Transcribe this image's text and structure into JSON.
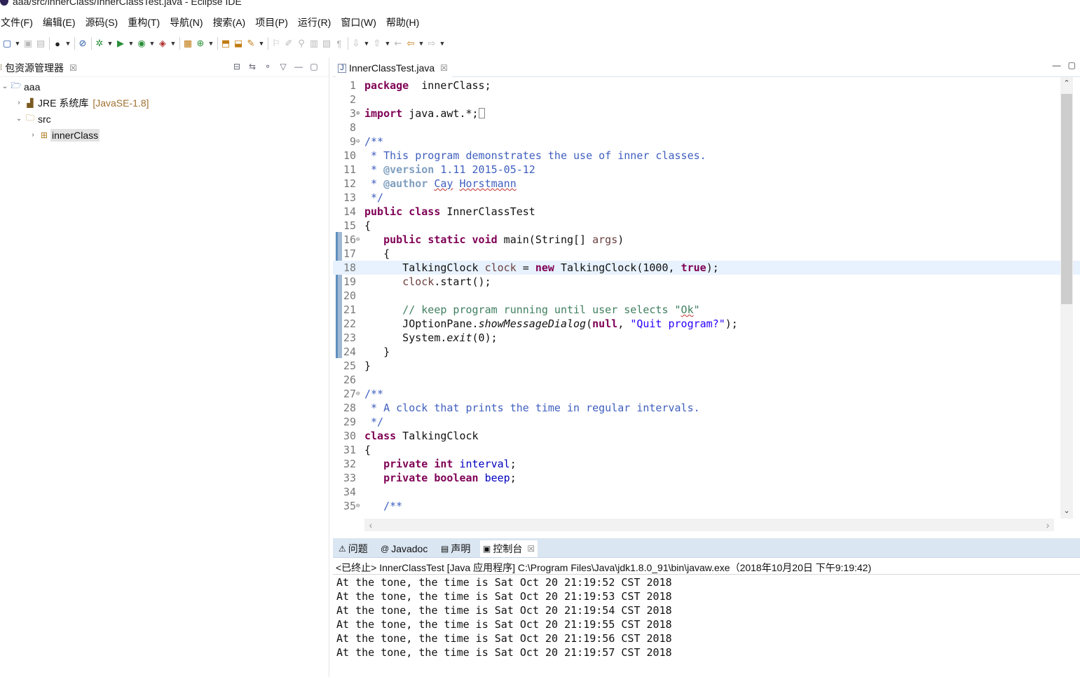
{
  "window": {
    "title": "aaa/src/innerClass/InnerClassTest.java - Eclipse IDE"
  },
  "menu": [
    "文件(F)",
    "编辑(E)",
    "源码(S)",
    "重构(T)",
    "导航(N)",
    "搜索(A)",
    "项目(P)",
    "运行(R)",
    "窗口(W)",
    "帮助(H)"
  ],
  "package_explorer": {
    "title": "包资源管理器",
    "tree": {
      "project": "aaa",
      "jre": "JRE 系统库",
      "jre_version": "[JavaSE-1.8]",
      "src": "src",
      "package": "innerClass"
    }
  },
  "editor": {
    "tab_title": "InnerClassTest.java",
    "current_line": 18,
    "lines": [
      {
        "n": "1",
        "segs": [
          [
            "kw",
            "package"
          ],
          [
            "",
            "  innerClass;"
          ]
        ]
      },
      {
        "n": "2",
        "segs": []
      },
      {
        "n": "3",
        "fold": "⊕",
        "segs": [
          [
            "kw",
            "import"
          ],
          [
            "",
            " java.awt.*;"
          ]
        ],
        "box": true
      },
      {
        "n": "8",
        "segs": []
      },
      {
        "n": "9",
        "fold": "⊖",
        "segs": [
          [
            "jd",
            "/**"
          ]
        ]
      },
      {
        "n": "10",
        "segs": [
          [
            "jd",
            " * This program demonstrates the use of inner classes."
          ]
        ]
      },
      {
        "n": "11",
        "segs": [
          [
            "jd",
            " * "
          ],
          [
            "jdt",
            "@version"
          ],
          [
            "jd",
            " 1.11 2015-05-12"
          ]
        ]
      },
      {
        "n": "12",
        "segs": [
          [
            "jd",
            " * "
          ],
          [
            "jdt",
            "@author"
          ],
          [
            "jd",
            " "
          ],
          [
            "jd sq",
            "Cay"
          ],
          [
            "jd",
            " "
          ],
          [
            "jd sq",
            "Horstmann"
          ]
        ]
      },
      {
        "n": "13",
        "segs": [
          [
            "jd",
            " */"
          ]
        ]
      },
      {
        "n": "14",
        "segs": [
          [
            "kw",
            "public"
          ],
          [
            "",
            " "
          ],
          [
            "kw",
            "class"
          ],
          [
            "",
            " InnerClassTest"
          ]
        ]
      },
      {
        "n": "15",
        "segs": [
          [
            "",
            "{"
          ]
        ]
      },
      {
        "n": "16",
        "fold": "⊖",
        "segs": [
          [
            "",
            "   "
          ],
          [
            "kw",
            "public"
          ],
          [
            "",
            " "
          ],
          [
            "kw",
            "static"
          ],
          [
            "",
            " "
          ],
          [
            "kw",
            "void"
          ],
          [
            "",
            " main(String[] "
          ],
          [
            "lv",
            "args"
          ],
          [
            "",
            ")"
          ]
        ]
      },
      {
        "n": "17",
        "segs": [
          [
            "",
            "   {"
          ]
        ]
      },
      {
        "n": "18",
        "segs": [
          [
            "",
            "      TalkingClock "
          ],
          [
            "lv",
            "clock"
          ],
          [
            "",
            " = "
          ],
          [
            "kw",
            "new"
          ],
          [
            "",
            " TalkingClock(1000, "
          ],
          [
            "kw",
            "true"
          ],
          [
            "",
            ");"
          ]
        ]
      },
      {
        "n": "19",
        "segs": [
          [
            "",
            "      "
          ],
          [
            "lv",
            "clock"
          ],
          [
            "",
            ".start();"
          ]
        ]
      },
      {
        "n": "20",
        "segs": []
      },
      {
        "n": "21",
        "segs": [
          [
            "",
            "      "
          ],
          [
            "cm",
            "// keep program running until user selects \""
          ],
          [
            "cm sq",
            "Ok"
          ],
          [
            "cm",
            "\""
          ]
        ]
      },
      {
        "n": "22",
        "segs": [
          [
            "",
            "      JOptionPane."
          ],
          [
            "itl",
            "showMessageDialog"
          ],
          [
            "",
            "("
          ],
          [
            "kw",
            "null"
          ],
          [
            "",
            ", "
          ],
          [
            "st",
            "\"Quit program?\""
          ],
          [
            "",
            ");"
          ]
        ]
      },
      {
        "n": "23",
        "segs": [
          [
            "",
            "      System."
          ],
          [
            "itl",
            "exit"
          ],
          [
            "",
            "(0);"
          ]
        ]
      },
      {
        "n": "24",
        "segs": [
          [
            "",
            "   }"
          ]
        ]
      },
      {
        "n": "25",
        "segs": [
          [
            "",
            "}"
          ]
        ]
      },
      {
        "n": "26",
        "segs": []
      },
      {
        "n": "27",
        "fold": "⊖",
        "segs": [
          [
            "jd",
            "/**"
          ]
        ]
      },
      {
        "n": "28",
        "segs": [
          [
            "jd",
            " * A clock that prints the time in regular intervals."
          ]
        ]
      },
      {
        "n": "29",
        "segs": [
          [
            "jd",
            " */"
          ]
        ]
      },
      {
        "n": "30",
        "segs": [
          [
            "kw",
            "class"
          ],
          [
            "",
            " TalkingClock"
          ]
        ]
      },
      {
        "n": "31",
        "segs": [
          [
            "",
            "{"
          ]
        ]
      },
      {
        "n": "32",
        "segs": [
          [
            "",
            "   "
          ],
          [
            "kw",
            "private"
          ],
          [
            "",
            " "
          ],
          [
            "kw",
            "int"
          ],
          [
            "",
            " "
          ],
          [
            "fld",
            "interval"
          ],
          [
            "",
            ";"
          ]
        ]
      },
      {
        "n": "33",
        "segs": [
          [
            "",
            "   "
          ],
          [
            "kw",
            "private"
          ],
          [
            "",
            " "
          ],
          [
            "kw",
            "boolean"
          ],
          [
            "",
            " "
          ],
          [
            "fld",
            "beep"
          ],
          [
            "",
            ";"
          ]
        ]
      },
      {
        "n": "34",
        "segs": []
      },
      {
        "n": "35",
        "fold": "⊖",
        "segs": [
          [
            "",
            "   "
          ],
          [
            "jd",
            "/**"
          ]
        ]
      }
    ]
  },
  "bottom_tabs": [
    {
      "label": "问题",
      "icon": "problems-icon",
      "glyph": "⚠"
    },
    {
      "label": "Javadoc",
      "icon": "javadoc-icon",
      "glyph": "@"
    },
    {
      "label": "声明",
      "icon": "declaration-icon",
      "glyph": "▤"
    },
    {
      "label": "控制台",
      "icon": "console-icon",
      "glyph": "▣",
      "active": true
    }
  ],
  "console": {
    "header": "<已终止> InnerClassTest [Java 应用程序] C:\\Program Files\\Java\\jdk1.8.0_91\\bin\\javaw.exe（2018年10月20日 下午9:19:42)",
    "lines": [
      "At the tone, the time is Sat Oct 20 21:19:52 CST 2018",
      "At the tone, the time is Sat Oct 20 21:19:53 CST 2018",
      "At the tone, the time is Sat Oct 20 21:19:54 CST 2018",
      "At the tone, the time is Sat Oct 20 21:19:55 CST 2018",
      "At the tone, the time is Sat Oct 20 21:19:56 CST 2018",
      "At the tone, the time is Sat Oct 20 21:19:57 CST 2018"
    ]
  },
  "colors": {
    "keyword": "#7f0055",
    "javadoc": "#3f5fbf",
    "comment": "#3f7f5f",
    "string": "#2a00ff",
    "current_line": "#e8f2fe",
    "console_tabbar": "#dae6f2"
  }
}
